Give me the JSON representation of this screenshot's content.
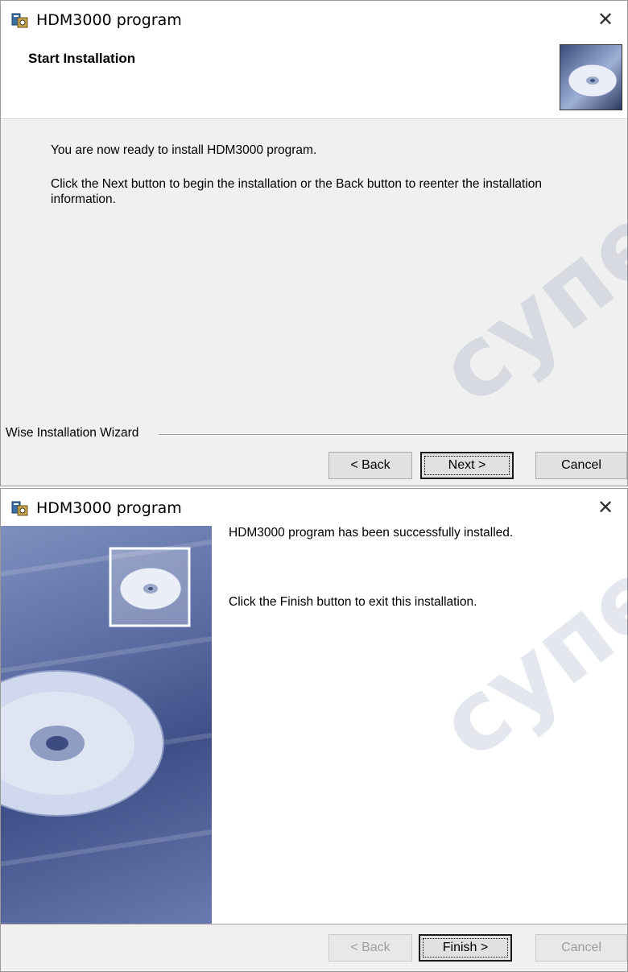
{
  "window1": {
    "title": "HDM3000 program",
    "heading": "Start Installation",
    "line1": "You are now ready to install HDM3000 program.",
    "line2": "Click the Next button to begin the installation or the Back button to reenter the installation information.",
    "group_label": "Wise Installation Wizard",
    "buttons": {
      "back": "< Back",
      "next": "Next >",
      "cancel": "Cancel"
    }
  },
  "window2": {
    "title": "HDM3000 program",
    "line1": "HDM3000 program has been successfully installed.",
    "line2": "Click the Finish button to exit this installation.",
    "buttons": {
      "back": "< Back",
      "finish": "Finish >",
      "cancel": "Cancel"
    }
  },
  "icons": {
    "app": "installer-icon",
    "close": "close-icon",
    "cd": "cd-disc-icon"
  },
  "watermark": "супер",
  "colors": {
    "dialog_bg": "#f0f0f0",
    "button_bg": "#e1e1e1",
    "sidebar_blue": "#5b6ca2"
  }
}
